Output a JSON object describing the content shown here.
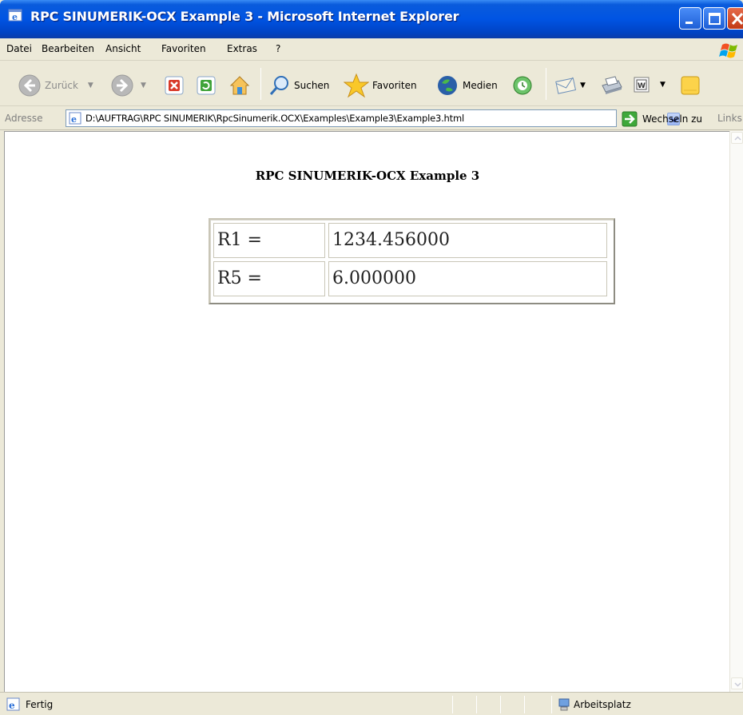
{
  "window": {
    "title": "RPC SINUMERIK-OCX Example 3 - Microsoft Internet Explorer"
  },
  "menu": {
    "items": [
      {
        "label": "Datei"
      },
      {
        "label": "Bearbeiten"
      },
      {
        "label": "Ansicht"
      },
      {
        "label": "Favoriten"
      },
      {
        "label": "Extras"
      },
      {
        "label": "?"
      }
    ]
  },
  "toolbar": {
    "back_label": "Zurück",
    "search_label": "Suchen",
    "favorites_label": "Favoriten",
    "media_label": "Medien"
  },
  "address": {
    "label": "Adresse",
    "url": "D:\\AUFTRAG\\RPC SINUMERIK\\RpcSinumerik.OCX\\Examples\\Example3\\Example3.html",
    "go_label": "Wechseln zu",
    "links_label": "Links"
  },
  "page": {
    "heading": "RPC SINUMERIK-OCX Example 3",
    "rows": [
      {
        "name": "R1 =",
        "value": "1234.456000"
      },
      {
        "name": "R5 =",
        "value": "6.000000"
      }
    ]
  },
  "status": {
    "text": "Fertig",
    "zone": "Arbeitsplatz"
  }
}
